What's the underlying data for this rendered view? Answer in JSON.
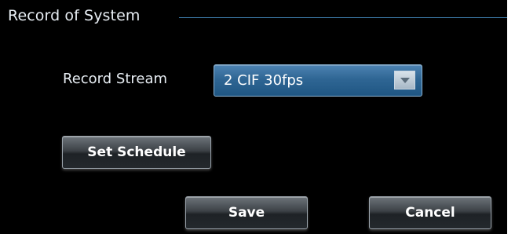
{
  "group": {
    "title": "Record of System"
  },
  "record_stream": {
    "label": "Record Stream",
    "selected_value": "2 CIF 30fps"
  },
  "buttons": {
    "set_schedule": "Set Schedule",
    "save": "Save",
    "cancel": "Cancel"
  },
  "colors": {
    "panel_background": "#000000",
    "group_line": "#3f7fb0",
    "select_background": "#2f6694",
    "text": "#e8eef4"
  }
}
